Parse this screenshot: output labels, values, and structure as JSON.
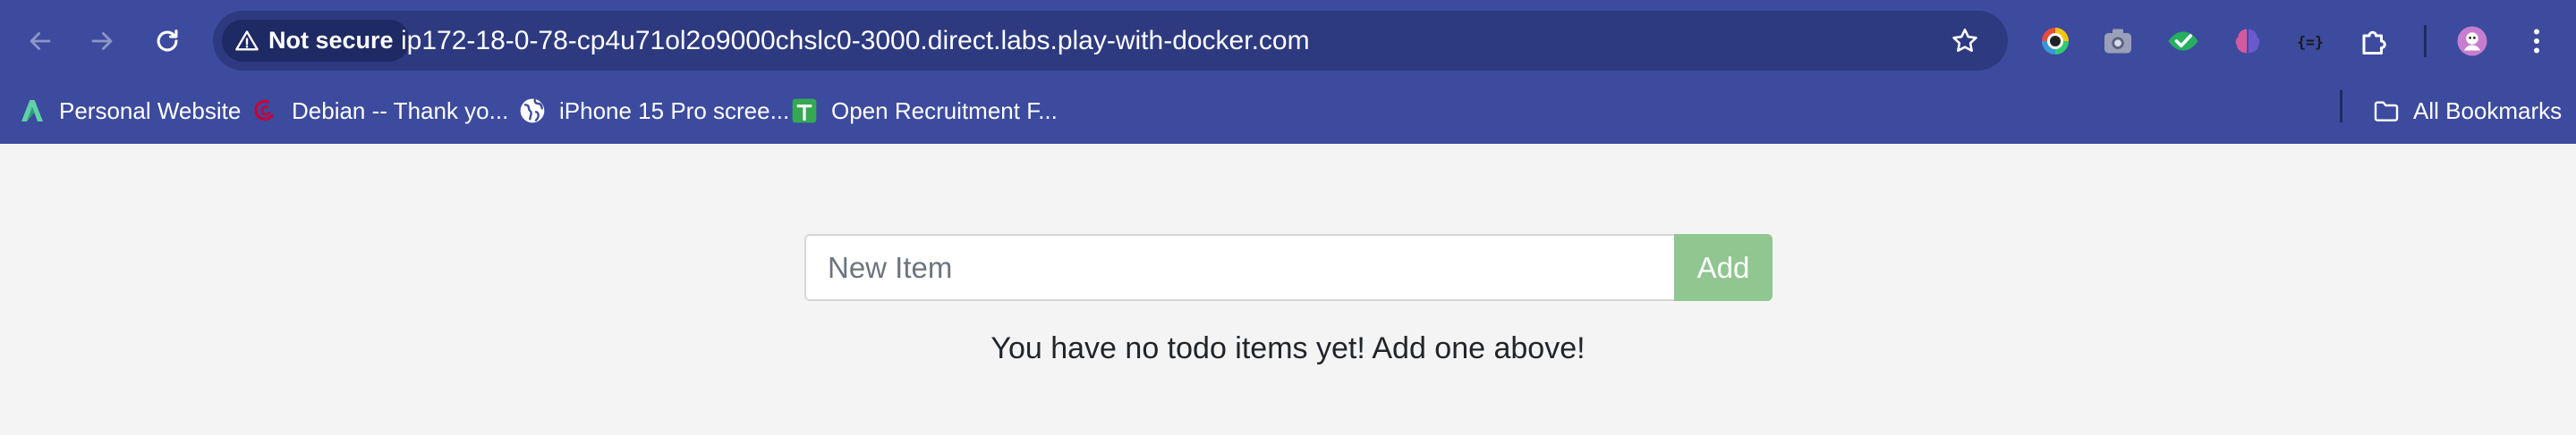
{
  "browser": {
    "nav": {
      "back_icon": "arrow-left-icon",
      "forward_icon": "arrow-right-icon",
      "reload_icon": "reload-icon"
    },
    "omnibox": {
      "security_label": "Not secure",
      "url": "ip172-18-0-78-cp4u71ol2o9000chslc0-3000.direct.labs.play-with-docker.com"
    },
    "extensions": [
      {
        "name": "color-picker-extension-icon"
      },
      {
        "name": "camera-extension-icon"
      },
      {
        "name": "eye-check-extension-icon"
      },
      {
        "name": "brain-extension-icon"
      },
      {
        "name": "json-extension-icon"
      },
      {
        "name": "puzzle-extensions-icon"
      }
    ],
    "profile_icon": "profile-avatar",
    "menu_icon": "kebab-menu-icon",
    "bookmarks": [
      {
        "label": "Personal Website",
        "icon": "site-logo-icon"
      },
      {
        "label": "Debian -- Thank yo...",
        "icon": "debian-logo-icon"
      },
      {
        "label": "iPhone 15 Pro scree...",
        "icon": "globe-icon"
      },
      {
        "label": "Open Recruitment F...",
        "icon": "google-forms-icon"
      }
    ],
    "all_bookmarks_label": "All Bookmarks"
  },
  "app": {
    "new_item_placeholder": "New Item",
    "add_button_label": "Add",
    "empty_message": "You have no todo items yet! Add one above!"
  },
  "colors": {
    "chrome_bg": "#3c4b9e",
    "omnibox_bg": "#2d3a80",
    "page_bg": "#f4f4f4",
    "add_button_bg": "#90c690"
  }
}
